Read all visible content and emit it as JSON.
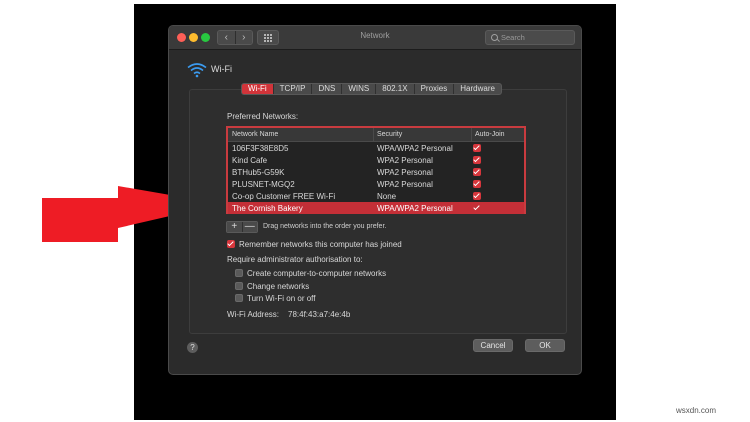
{
  "window": {
    "title": "Network"
  },
  "search": {
    "placeholder": "Search"
  },
  "header": {
    "label": "Wi-Fi"
  },
  "tabs": [
    "Wi-Fi",
    "TCP/IP",
    "DNS",
    "WINS",
    "802.1X",
    "Proxies",
    "Hardware"
  ],
  "active_tab": "Wi-Fi",
  "preferred": {
    "label": "Preferred Networks:",
    "columns": [
      "Network Name",
      "Security",
      "Auto-Join"
    ],
    "rows": [
      {
        "name": "106F3F38E8D5",
        "security": "WPA/WPA2 Personal",
        "auto_join": true
      },
      {
        "name": "Kind Cafe",
        "security": "WPA2 Personal",
        "auto_join": true
      },
      {
        "name": "BTHub5-G59K",
        "security": "WPA2 Personal",
        "auto_join": true
      },
      {
        "name": "PLUSNET-MGQ2",
        "security": "WPA2 Personal",
        "auto_join": true
      },
      {
        "name": "Co-op Customer FREE Wi-Fi",
        "security": "None",
        "auto_join": true
      },
      {
        "name": "The Cornish Bakery",
        "security": "WPA/WPA2 Personal",
        "auto_join": true
      }
    ],
    "selected_index": 5
  },
  "controls": {
    "add": "+",
    "remove": "—",
    "drag_hint": "Drag networks into the order you prefer."
  },
  "remember": {
    "label": "Remember networks this computer has joined",
    "checked": true
  },
  "admin": {
    "label": "Require administrator authorisation to:",
    "options": [
      {
        "label": "Create computer-to-computer networks",
        "checked": false
      },
      {
        "label": "Change networks",
        "checked": false
      },
      {
        "label": "Turn Wi-Fi on or off",
        "checked": false
      }
    ]
  },
  "address": {
    "label": "Wi-Fi Address:",
    "value": "78:4f:43:a7:4e:4b"
  },
  "footer": {
    "help": "?",
    "cancel": "Cancel",
    "ok": "OK"
  },
  "watermark": "wsxdn.com",
  "colors": {
    "accent": "#d1343a",
    "window": "#2b2b2b",
    "arrow": "#ee1c25"
  }
}
